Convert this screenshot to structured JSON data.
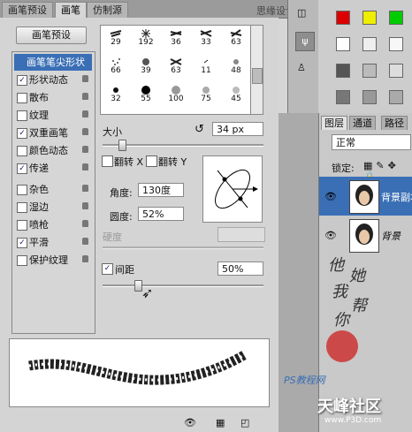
{
  "tabs": [
    {
      "label": "画笔预设"
    },
    {
      "label": "画笔"
    },
    {
      "label": "仿制源"
    }
  ],
  "top_watermark": "思缘设计论坛",
  "preset_button": "画笔预设",
  "options": [
    {
      "label": "画笔笔尖形状",
      "checked": null,
      "selected": true
    },
    {
      "label": "形状动态",
      "checked": true
    },
    {
      "label": "散布",
      "checked": false
    },
    {
      "label": "纹理",
      "checked": false
    },
    {
      "label": "双重画笔",
      "checked": true
    },
    {
      "label": "颜色动态",
      "checked": false
    },
    {
      "label": "传递",
      "checked": true
    },
    {
      "label": "杂色",
      "checked": false
    },
    {
      "label": "湿边",
      "checked": false
    },
    {
      "label": "喷枪",
      "checked": false
    },
    {
      "label": "平滑",
      "checked": true
    },
    {
      "label": "保护纹理",
      "checked": false
    }
  ],
  "brush_numbers": [
    [
      "29",
      "192",
      "36",
      "33",
      "63"
    ],
    [
      "66",
      "39",
      "63",
      "11",
      "48"
    ],
    [
      "32",
      "55",
      "100",
      "75",
      "45"
    ]
  ],
  "size": {
    "label": "大小",
    "value": "34 px",
    "fraction": 0.12
  },
  "flip_x": "翻转 X",
  "flip_y": "翻转 Y",
  "angle": {
    "label": "角度:",
    "value": "130度"
  },
  "roundness": {
    "label": "圆度:",
    "value": "52%"
  },
  "hardness": {
    "label": "硬度"
  },
  "spacing": {
    "label": "间距",
    "checked": true,
    "value": "50%",
    "fraction": 0.22
  },
  "layers": {
    "tabs": [
      "图层",
      "通道",
      "路径"
    ],
    "blend_mode": "正常",
    "lock_label": "锁定:",
    "items": [
      {
        "name": "背景副本",
        "selected": true
      },
      {
        "name": "背景",
        "selected": false
      }
    ]
  },
  "signature": [
    "他",
    "她",
    "我",
    "帮",
    "你"
  ],
  "site_watermark": "PS教程网",
  "brand": "天峰社区",
  "brand_url": "www.P3D.com"
}
